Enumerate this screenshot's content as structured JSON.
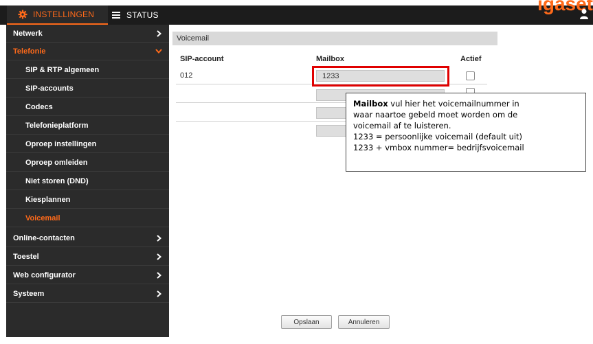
{
  "header": {
    "tabs": [
      {
        "label": "INSTELLINGEN",
        "icon": "gear-icon",
        "active": true
      },
      {
        "label": "STATUS",
        "icon": "menu-icon",
        "active": false
      }
    ],
    "logo_fragment": "igaset",
    "accent_color": "#ff6a1a"
  },
  "sidebar": {
    "items": [
      {
        "label": "Netwerk",
        "level": 0,
        "chevron": "right"
      },
      {
        "label": "Telefonie",
        "level": 0,
        "chevron": "down",
        "active": true
      },
      {
        "label": "SIP & RTP algemeen",
        "level": 1
      },
      {
        "label": "SIP-accounts",
        "level": 1
      },
      {
        "label": "Codecs",
        "level": 1
      },
      {
        "label": "Telefonieplatform",
        "level": 1
      },
      {
        "label": "Oproep instellingen",
        "level": 1
      },
      {
        "label": "Oproep omleiden",
        "level": 1
      },
      {
        "label": "Niet storen (DND)",
        "level": 1
      },
      {
        "label": "Kiesplannen",
        "level": 1
      },
      {
        "label": "Voicemail",
        "level": 1,
        "active": true
      },
      {
        "label": "Online-contacten",
        "level": 0,
        "chevron": "right"
      },
      {
        "label": "Toestel",
        "level": 0,
        "chevron": "right"
      },
      {
        "label": "Web configurator",
        "level": 0,
        "chevron": "right"
      },
      {
        "label": "Systeem",
        "level": 0,
        "chevron": "right"
      }
    ]
  },
  "main": {
    "section_title": "Voicemail",
    "columns": {
      "account": "SIP-account",
      "mailbox": "Mailbox",
      "active": "Actief"
    },
    "rows": [
      {
        "account": "012",
        "mailbox": "1233",
        "active": false
      },
      {
        "account": "",
        "mailbox": "",
        "active": false
      },
      {
        "account": "",
        "mailbox": "",
        "active": false
      },
      {
        "account": "",
        "mailbox": "",
        "active": false
      }
    ],
    "buttons": {
      "save": "Opslaan",
      "cancel": "Annuleren"
    }
  },
  "callout": {
    "title": "Mailbox",
    "line1_rest": " vul hier het voicemailnummer in",
    "line2": "waar naartoe gebeld moet worden om de",
    "line3": "voicemail af te luisteren.",
    "line4": "1233 = persoonlijke voicemail (default uit)",
    "line5": "1233 + vmbox nummer= bedrijfsvoicemail"
  }
}
